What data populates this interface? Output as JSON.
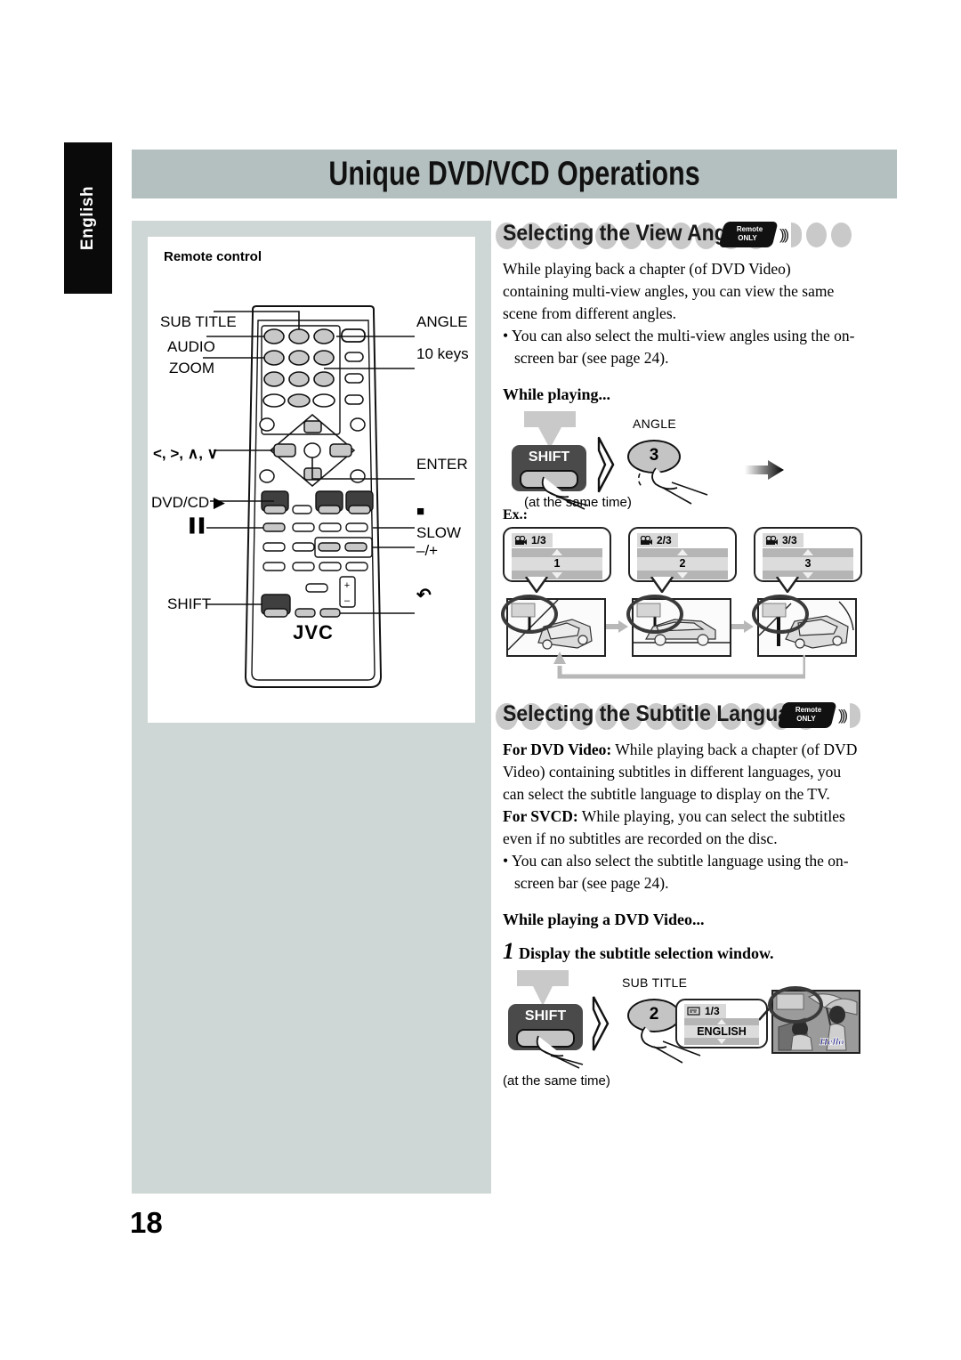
{
  "page": {
    "language_tab": "English",
    "title": "Unique DVD/VCD Operations",
    "page_number": "18"
  },
  "remote_panel": {
    "caption": "Remote control",
    "brand": "JVC",
    "callouts_left": [
      "SUB TITLE",
      "AUDIO",
      "ZOOM",
      "<, >, ∧, ∨",
      "DVD/CD ▶",
      "▐▐",
      "SHIFT"
    ],
    "callouts_right": [
      "ANGLE",
      "10 keys",
      "ENTER",
      "■",
      "SLOW –/+",
      "↶"
    ]
  },
  "section_angle": {
    "heading": "Selecting the View Angle",
    "badge_line1": "Remote",
    "badge_line2": "ONLY",
    "paragraph": "While playing back a chapter (of DVD Video) containing multi-view angles, you can view the same scene from different angles.",
    "bullet": "• You can also select the multi-view angles using the on-screen bar (see page 24).",
    "while_playing": "While playing...",
    "shift_label": "SHIFT",
    "key_label": "ANGLE",
    "key_number": "3",
    "at_same_time": "(at the same time)",
    "ex_label": "Ex.:",
    "osd_screens": [
      {
        "counter": "1/3",
        "value": "1"
      },
      {
        "counter": "2/3",
        "value": "2"
      },
      {
        "counter": "3/3",
        "value": "3"
      }
    ]
  },
  "section_subtitle": {
    "heading": "Selecting the Subtitle Language",
    "badge_line1": "Remote",
    "badge_line2": "ONLY",
    "para_dvd_bold": "For DVD Video:",
    "para_dvd": " While playing back a chapter (of DVD Video) containing subtitles in different languages, you can select the subtitle language to display on the TV.",
    "para_svcd_bold": "For SVCD:",
    "para_svcd": " While playing, you can select the subtitles even if no subtitles are recorded on the disc.",
    "bullet": "• You can also select the subtitle language using the on-screen bar (see page 24).",
    "while_playing": "While playing a DVD Video...",
    "step_number": "1",
    "step_text": "Display the subtitle selection window.",
    "shift_label": "SHIFT",
    "key_label": "SUB TITLE",
    "key_number": "2",
    "at_same_time": "(at the same time)",
    "osd": {
      "counter": "1/3",
      "value": "ENGLISH"
    },
    "tv_subtitle_text": "Hello"
  },
  "colors": {
    "title_bar": "#b4bfbf",
    "grey_panel": "#ced7d5",
    "bubble": "#c9c9c9",
    "key_grey": "#c4c4c4",
    "shift_dark": "#4a4a4a"
  }
}
